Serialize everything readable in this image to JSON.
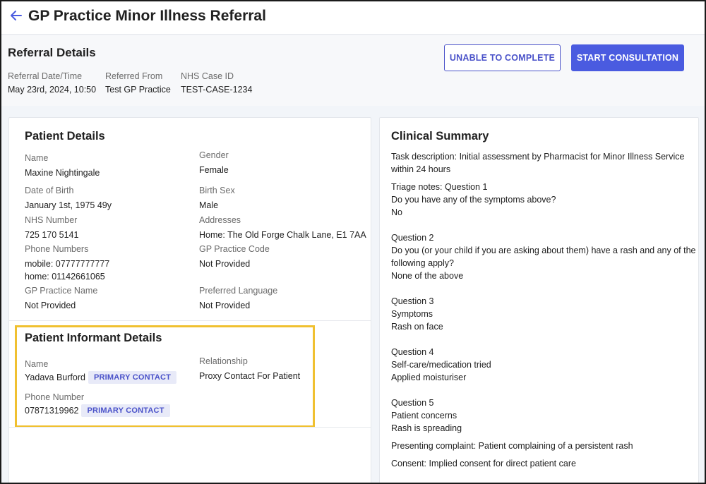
{
  "header": {
    "title": "GP Practice Minor Illness Referral",
    "back_icon": "arrow-left-icon",
    "accent_color": "#4a5be0"
  },
  "referral": {
    "title": "Referral Details",
    "date_label": "Referral Date/Time",
    "date_value": "May 23rd, 2024, 10:50",
    "from_label": "Referred From",
    "from_value": "Test GP Practice",
    "case_label": "NHS Case ID",
    "case_value": "TEST-CASE-1234",
    "unable_label": "UNABLE TO COMPLETE",
    "start_label": "START CONSULTATION"
  },
  "patient": {
    "title": "Patient Details",
    "name_label": "Name",
    "name_value": "Maxine Nightingale",
    "gender_label": "Gender",
    "gender_value": "Female",
    "dob_label": "Date of Birth",
    "dob_value": "January 1st, 1975 49y",
    "birth_sex_label": "Birth Sex",
    "birth_sex_value": "Male",
    "nhs_label": "NHS Number",
    "nhs_value": "725 170 5141",
    "address_label": "Addresses",
    "address_value": "Home: The Old Forge Chalk Lane, E1 7AA",
    "phones_label": "Phone Numbers",
    "phone_mobile": "mobile: 07777777777",
    "phone_home": "home: 01142661065",
    "gp_code_label": "GP Practice Code",
    "gp_code_value": "Not Provided",
    "gp_name_label": "GP Practice Name",
    "gp_name_value": "Not Provided",
    "language_label": "Preferred Language",
    "language_value": "Not Provided"
  },
  "informant": {
    "title": "Patient Informant Details",
    "name_label": "Name",
    "name_value": "Yadava Burford",
    "name_badge": "PRIMARY CONTACT",
    "relationship_label": "Relationship",
    "relationship_value": "Proxy Contact For Patient",
    "phone_label": "Phone Number",
    "phone_value": "07871319962",
    "phone_badge": "PRIMARY CONTACT"
  },
  "clinical": {
    "title": "Clinical Summary",
    "task_line1": "Task description: Initial assessment by Pharmacist for Minor Illness Service",
    "task_line2": "within 24 hours",
    "q1_line1": "Triage notes: Question 1",
    "q1_line2": "Do you have any of the symptoms above?",
    "q1_line3": "No",
    "q2_line1": "Question 2",
    "q2_line2": "Do you (or your child if you are asking about them) have a rash and any of the",
    "q2_line3": "following apply?",
    "q2_line4": "None of the above",
    "q3_line1": "Question 3",
    "q3_line2": "Symptoms",
    "q3_line3": "Rash on face",
    "q4_line1": "Question 4",
    "q4_line2": "Self-care/medication tried",
    "q4_line3": "Applied moisturiser",
    "q5_line1": "Question 5",
    "q5_line2": "Patient concerns",
    "q5_line3": "Rash is spreading",
    "presenting": "Presenting complaint: Patient complaining of a persistent rash",
    "consent": "Consent: Implied consent for direct patient care"
  }
}
